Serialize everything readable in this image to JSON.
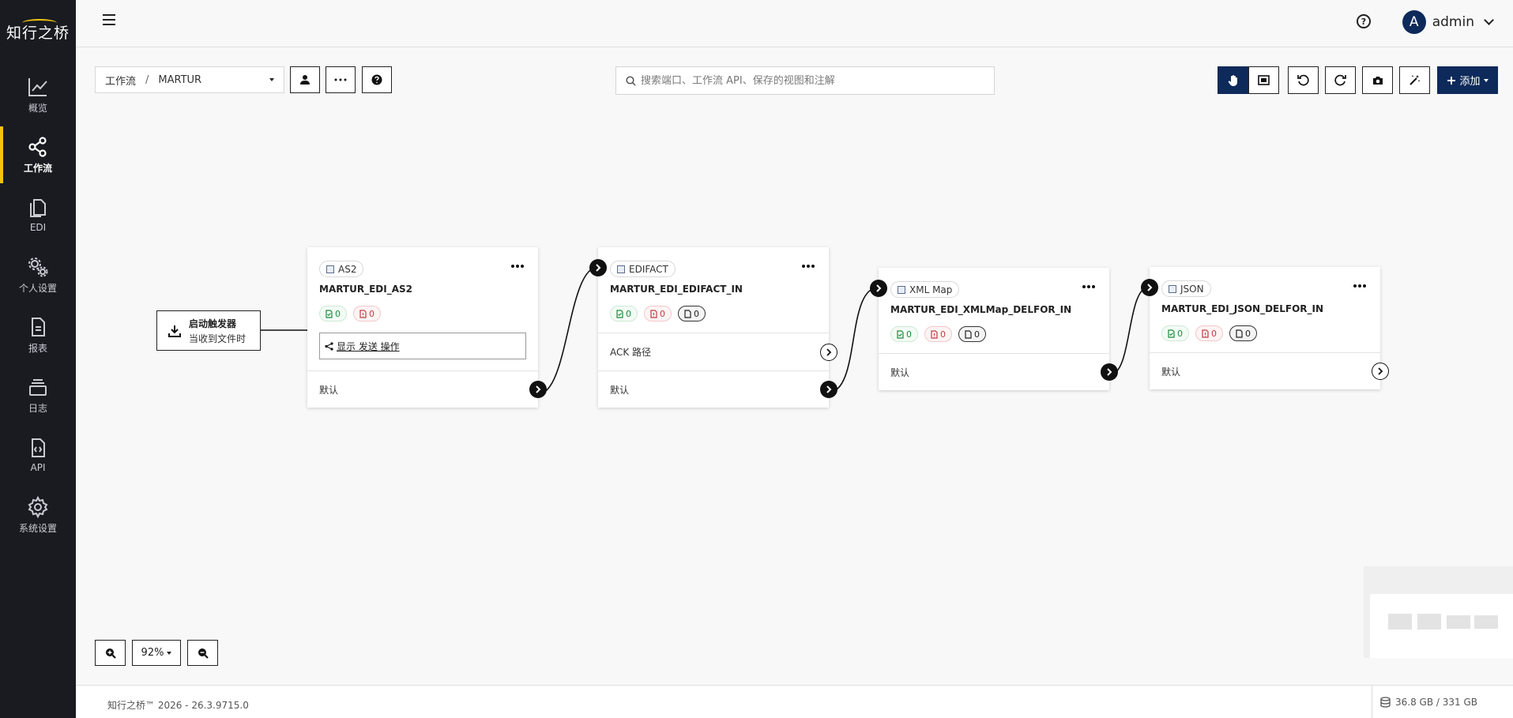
{
  "app": {
    "logo_text": "知行之桥"
  },
  "sidebar": {
    "items": [
      {
        "label": "概览",
        "icon": "chart-line-icon"
      },
      {
        "label": "工作流",
        "icon": "share-nodes-icon",
        "active": true
      },
      {
        "label": "EDI",
        "icon": "documents-icon"
      },
      {
        "label": "个人设置",
        "icon": "gears-icon"
      },
      {
        "label": "报表",
        "icon": "report-icon"
      },
      {
        "label": "日志",
        "icon": "log-icon"
      },
      {
        "label": "API",
        "icon": "api-file-icon"
      },
      {
        "label": "系统设置",
        "icon": "gear-icon"
      }
    ]
  },
  "header": {
    "user_initial": "A",
    "user_name": "admin",
    "help_glyph": "?"
  },
  "toolbar": {
    "breadcrumb_root": "工作流",
    "breadcrumb_sep": "/",
    "breadcrumb_current": "MARTUR",
    "search_placeholder": "搜索端口、工作流 API、保存的视图和注解",
    "add_label": "添加"
  },
  "canvas": {
    "trigger": {
      "title": "启动触发器",
      "subtitle": "当收到文件时"
    },
    "nodes": [
      {
        "type": "AS2",
        "name": "MARTUR_EDI_AS2",
        "counts": [
          "0",
          "0"
        ],
        "show_action": "显示 发送 操作",
        "routes": [
          "默认"
        ]
      },
      {
        "type": "EDIFACT",
        "name": "MARTUR_EDI_EDIFACT_IN",
        "counts": [
          "0",
          "0",
          "0"
        ],
        "routes": [
          "ACK 路径",
          "默认"
        ]
      },
      {
        "type": "XML Map",
        "name": "MARTUR_EDI_XMLMap_DELFOR_IN",
        "counts": [
          "0",
          "0",
          "0"
        ],
        "routes": [
          "默认"
        ]
      },
      {
        "type": "JSON",
        "name": "MARTUR_EDI_JSON_DELFOR_IN",
        "counts": [
          "0",
          "0",
          "0"
        ],
        "routes": [
          "默认"
        ]
      }
    ]
  },
  "zoom": {
    "level": "92%"
  },
  "footer": {
    "version": "知行之桥™ 2026 - 26.3.9715.0",
    "disk": "36.8 GB / 331 GB"
  },
  "colors": {
    "sidebar_bg": "#191b21",
    "accent": "#f2c30f",
    "primary": "#0e2a5a",
    "success": "#1e8a3c",
    "error": "#c23a43"
  }
}
